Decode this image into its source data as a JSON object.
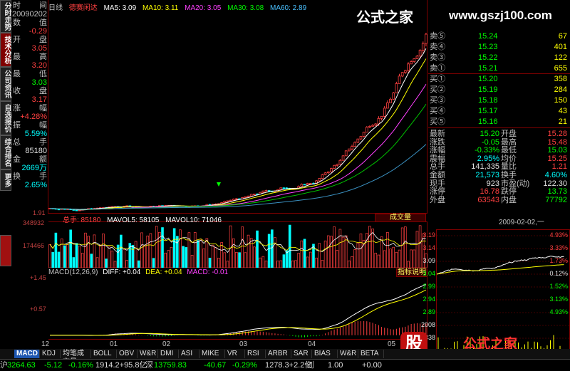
{
  "vtabs": [
    "分时走势",
    "技术分析",
    "公司资讯",
    "自选报价",
    "综合排名",
    "更多"
  ],
  "vtab_active_index": 1,
  "left_info": {
    "rows": [
      {
        "label": "时",
        "value": "间",
        "color": "#c0c0c0"
      },
      {
        "label": "",
        "value": "20090202",
        "color": "#c0c0c0"
      },
      {
        "label": "数",
        "value": "值",
        "color": "#c0c0c0"
      },
      {
        "label": "",
        "value": "-0.29",
        "color": "#ff4040"
      },
      {
        "label": "开",
        "value": "盘",
        "color": "#c0c0c0"
      },
      {
        "label": "",
        "value": "3.05",
        "color": "#ff4040"
      },
      {
        "label": "最",
        "value": "高",
        "color": "#c0c0c0"
      },
      {
        "label": "",
        "value": "3.20",
        "color": "#ff4040"
      },
      {
        "label": "最",
        "value": "低",
        "color": "#c0c0c0"
      },
      {
        "label": "",
        "value": "3.03",
        "color": "#00ff00"
      },
      {
        "label": "收",
        "value": "盘",
        "color": "#c0c0c0"
      },
      {
        "label": "",
        "value": "3.17",
        "color": "#ff4040"
      },
      {
        "label": "涨",
        "value": "幅",
        "color": "#c0c0c0"
      },
      {
        "label": "",
        "value": "+4.28%",
        "color": "#ff4040"
      },
      {
        "label": "振",
        "value": "幅",
        "color": "#c0c0c0"
      },
      {
        "label": "",
        "value": "5.59%",
        "color": "#00ffff"
      },
      {
        "label": "总",
        "value": "手",
        "color": "#c0c0c0"
      },
      {
        "label": "",
        "value": "85180",
        "color": "#e0e0e0"
      },
      {
        "label": "金",
        "value": "额",
        "color": "#c0c0c0"
      },
      {
        "label": "",
        "value": "2669万",
        "color": "#00ffff"
      },
      {
        "label": "换",
        "value": "手",
        "color": "#c0c0c0"
      },
      {
        "label": "",
        "value": "2.65%",
        "color": "#00ffff"
      }
    ]
  },
  "main_header": {
    "period": "日线",
    "stock": "德赛闲达",
    "ma5": "MA5: 3.09",
    "ma10": "MA10: 3.11",
    "ma20": "MA20: 3.05",
    "ma30": "MA30: 3.08",
    "ma60": "MA60: 2.89"
  },
  "main_y_label": "1.91",
  "volume_header": {
    "total": "总手: 85180",
    "mavol5": "MAVOL5: 58105",
    "mavol10": "MAVOL10: 71046",
    "button": "成交量"
  },
  "volume_y_labels": [
    "348932",
    "174466"
  ],
  "macd_header": {
    "title": "MACD(12,26,9)",
    "diff": "DIFF: +0.04",
    "dea": "DEA: +0.04",
    "macd": "MACD: -0.01",
    "button": "指标说明"
  },
  "macd_y_labels": [
    "+1.45",
    "+0.57"
  ],
  "x_axis_labels": [
    "12",
    "01",
    "02",
    "03",
    "04",
    "05"
  ],
  "watermark": {
    "text": "公式之家",
    "url": "www.gszj100.com"
  },
  "order_book": {
    "asks": [
      {
        "label": "卖⑤",
        "price": "15.24",
        "vol": "67"
      },
      {
        "label": "卖④",
        "price": "15.23",
        "vol": "401"
      },
      {
        "label": "卖③",
        "price": "15.22",
        "vol": "122"
      },
      {
        "label": "卖①",
        "price": "15.21",
        "vol": "655"
      }
    ],
    "bids": [
      {
        "label": "买①",
        "price": "15.20",
        "vol": "358"
      },
      {
        "label": "买②",
        "price": "15.19",
        "vol": "284"
      },
      {
        "label": "买③",
        "price": "15.18",
        "vol": "150"
      },
      {
        "label": "买④",
        "price": "15.17",
        "vol": "43"
      },
      {
        "label": "买⑤",
        "price": "15.16",
        "vol": "21"
      }
    ]
  },
  "stats": [
    {
      "l1": "最新",
      "v1": "15.20",
      "c1": "#00ff00",
      "l2": "开盘",
      "v2": "15.28",
      "c2": "#ff4040"
    },
    {
      "l1": "涨跌",
      "v1": "-0.05",
      "c1": "#00ff00",
      "l2": "最高",
      "v2": "15.48",
      "c2": "#ff4040"
    },
    {
      "l1": "涨幅",
      "v1": "-0.33%",
      "c1": "#00ff00",
      "l2": "最低",
      "v2": "15.03",
      "c2": "#00ff00"
    },
    {
      "l1": "震幅",
      "v1": "2.95%",
      "c1": "#00ffff",
      "l2": "均价",
      "v2": "15.25",
      "c2": "#ff4040"
    },
    {
      "l1": "总手",
      "v1": "141,335",
      "c1": "#e0e0e0",
      "l2": "量比",
      "v2": "1.21",
      "c2": "#ff4040"
    },
    {
      "l1": "金额",
      "v1": "21,573",
      "c1": "#00ffff",
      "l2": "换手",
      "v2": "4.60%",
      "c2": "#00ffff"
    },
    {
      "l1": "现手",
      "v1": "923",
      "c1": "#e0e0e0",
      "l2": "市盈(动)",
      "v2": "122.30",
      "c2": "#e0e0e0"
    },
    {
      "l1": "涨停",
      "v1": "16.78",
      "c1": "#ff4040",
      "l2": "跌停",
      "v2": "13.73",
      "c2": "#00ff00"
    },
    {
      "l1": "外盘",
      "v1": "63543",
      "c1": "#ff4040",
      "l2": "内盘",
      "v2": "77792",
      "c2": "#00ff00"
    }
  ],
  "mini_chart": {
    "time": "2009-02-02,一",
    "left_prices": [
      "3.19",
      "3.14",
      "3.09",
      "3.04",
      "2.99",
      "2.94",
      "2.89",
      "2008",
      "1338"
    ],
    "right_pcts": [
      "4.93%",
      "3.33%",
      "1.73%",
      "0.12%",
      "1.52%",
      "3.13%",
      "4.93%"
    ]
  },
  "bottom_tabs": [
    "MACD",
    "KDJ",
    "均笔成交量",
    "BOLL",
    "OBV",
    "W&R",
    "DMI",
    "ASI",
    "MIKE",
    "VR",
    "RSI",
    "ARBR",
    "SAR",
    "BIAS",
    "W&R",
    "BETA"
  ],
  "bottom_tab_active": 0,
  "status": [
    {
      "text": "沪",
      "color": "#c0c0c0"
    },
    {
      "text": "3264.63",
      "color": "#00ff00"
    },
    {
      "text": "-5.12",
      "color": "#00ff00"
    },
    {
      "text": "-0.16%",
      "color": "#00ff00"
    },
    {
      "text": "1914.2+95.8亿",
      "color": "#e0e0e0"
    },
    {
      "text": "深",
      "color": "#c0c0c0"
    },
    {
      "text": "13759.83",
      "color": "#00ff00"
    },
    {
      "text": "-40.67",
      "color": "#00ff00"
    },
    {
      "text": "-0.29%",
      "color": "#00ff00"
    },
    {
      "text": "1278.3+2.2亿",
      "color": "#e0e0e0"
    },
    {
      "text": "创",
      "color": "#c0c0c0"
    },
    {
      "text": "1.00",
      "color": "#e0e0e0"
    },
    {
      "text": "+0.00",
      "color": "#e0e0e0"
    }
  ],
  "colors": {
    "up": "#ff4040",
    "down": "#00ffff",
    "accent": "#800000"
  }
}
